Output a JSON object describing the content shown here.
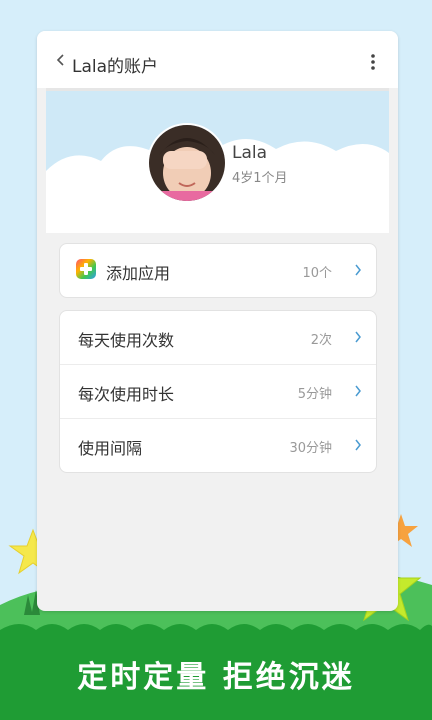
{
  "header": {
    "title": "Lala的账户"
  },
  "profile": {
    "name": "Lala",
    "age": "4岁1个月"
  },
  "apps_row": {
    "label": "添加应用",
    "value": "10个"
  },
  "settings": [
    {
      "label": "每天使用次数",
      "value": "2次"
    },
    {
      "label": "每次使用时长",
      "value": "5分钟"
    },
    {
      "label": "使用间隔",
      "value": "30分钟"
    }
  ],
  "slogan": "定时定量 拒绝沉迷",
  "colors": {
    "background": "#d6eefa",
    "grass": "#2fae3f",
    "grass_dark": "#1f9c34",
    "star_yellow": "#f5e84b",
    "star_orange": "#f7a23f",
    "star_green": "#c4ea2c"
  }
}
